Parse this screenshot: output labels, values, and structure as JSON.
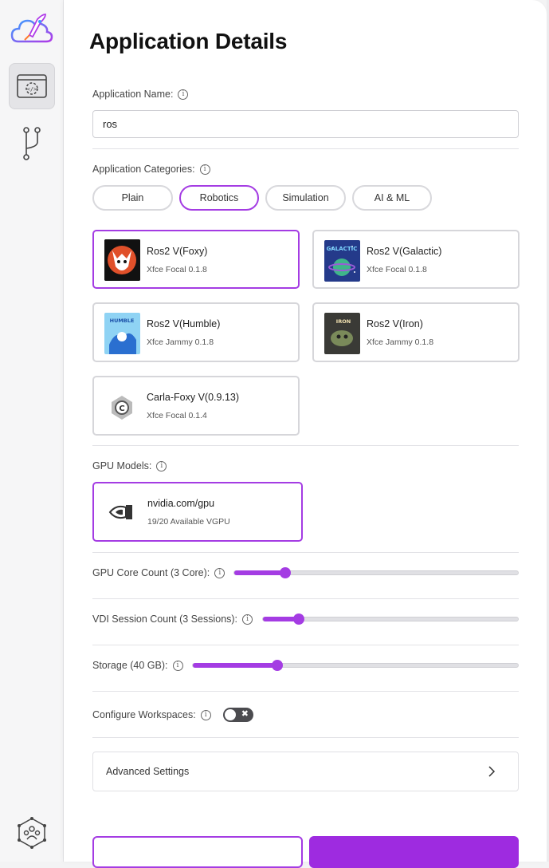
{
  "sidebar": {
    "logo_icon": "rocket-cloud-icon",
    "items": [
      {
        "icon": "code-window-icon",
        "active": true
      },
      {
        "icon": "git-branch-icon",
        "active": false
      }
    ],
    "bottom_icon": "team-network-icon"
  },
  "page": {
    "title": "Application Details"
  },
  "app_name": {
    "label": "Application Name:",
    "value": "ros"
  },
  "categories": {
    "label": "Application Categories:",
    "chips": [
      {
        "label": "Plain",
        "selected": false
      },
      {
        "label": "Robotics",
        "selected": true
      },
      {
        "label": "Simulation",
        "selected": false
      },
      {
        "label": "AI & ML",
        "selected": false
      }
    ]
  },
  "images": [
    {
      "name": "Ros2 V(Foxy)",
      "sub": "Xfce Focal 0.1.8",
      "selected": true
    },
    {
      "name": "Ros2 V(Galactic)",
      "sub": "Xfce Focal 0.1.8",
      "selected": false
    },
    {
      "name": "Ros2 V(Humble)",
      "sub": "Xfce Jammy 0.1.8",
      "selected": false
    },
    {
      "name": "Ros2 V(Iron)",
      "sub": "Xfce Jammy 0.1.8",
      "selected": false
    },
    {
      "name": "Carla-Foxy V(0.9.13)",
      "sub": "Xfce Focal 0.1.4",
      "selected": false
    }
  ],
  "gpu": {
    "label": "GPU Models:",
    "name": "nvidia.com/gpu",
    "sub": "19/20 Available VGPU",
    "icon": "nvidia-icon"
  },
  "sliders": {
    "gpu_core": {
      "label": "GPU Core Count (3 Core):",
      "fraction": 0.18
    },
    "vdi": {
      "label": "VDI Session Count (3 Sessions):",
      "fraction": 0.14
    },
    "storage": {
      "label": "Storage (40 GB):",
      "fraction": 0.26
    }
  },
  "workspaces": {
    "label": "Configure Workspaces:",
    "enabled": false
  },
  "advanced": {
    "label": "Advanced Settings"
  },
  "colors": {
    "accent": "#a43ce3"
  }
}
